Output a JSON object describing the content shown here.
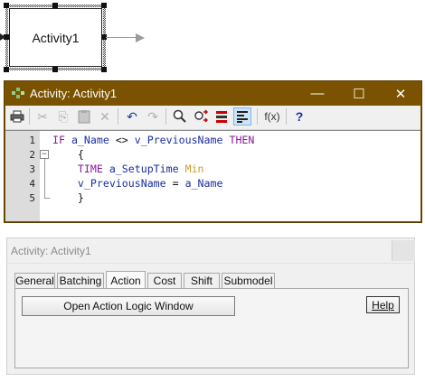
{
  "canvas": {
    "activity_label": "Activity1"
  },
  "activity_window": {
    "title": "Activity: Activity1",
    "controls": {
      "minimize": "—",
      "maximize": "☐",
      "close": "✕"
    },
    "toolbar": {
      "print": "🖶",
      "cut": "✂",
      "copy": "⎘",
      "paste": "📋",
      "delete": "✕",
      "undo": "↶",
      "redo": "↷",
      "find": "🔍",
      "replace": "⇄",
      "indent": "⇥",
      "format": "≡",
      "function": "f(x)",
      "help": "?"
    },
    "line_numbers": [
      "1",
      "2",
      "3",
      "4",
      "5"
    ],
    "code": {
      "l1_if": "IF",
      "l1_a": " a_Name ",
      "l1_op": "<>",
      "l1_b": " v_PreviousName ",
      "l1_then": "THEN",
      "l2": "    {",
      "l3_time": "    TIME",
      "l3_var": " a_SetupTime ",
      "l3_unit": "Min",
      "l4_var": "    v_PreviousName",
      "l4_op": " = ",
      "l4_val": "a_Name",
      "l5": "    }"
    }
  },
  "properties": {
    "title": "Activity: Activity1",
    "tabs": [
      "General",
      "Batching",
      "Action",
      "Cost",
      "Shift",
      "Submodel"
    ],
    "selected_tab": "Action",
    "open_button": "Open Action Logic Window",
    "help_button": "Help"
  },
  "colors": {
    "titlebar": "#7a5200",
    "keyword": "#8a1a9a",
    "variable": "#1a2f9e",
    "unit": "#d09a30"
  }
}
